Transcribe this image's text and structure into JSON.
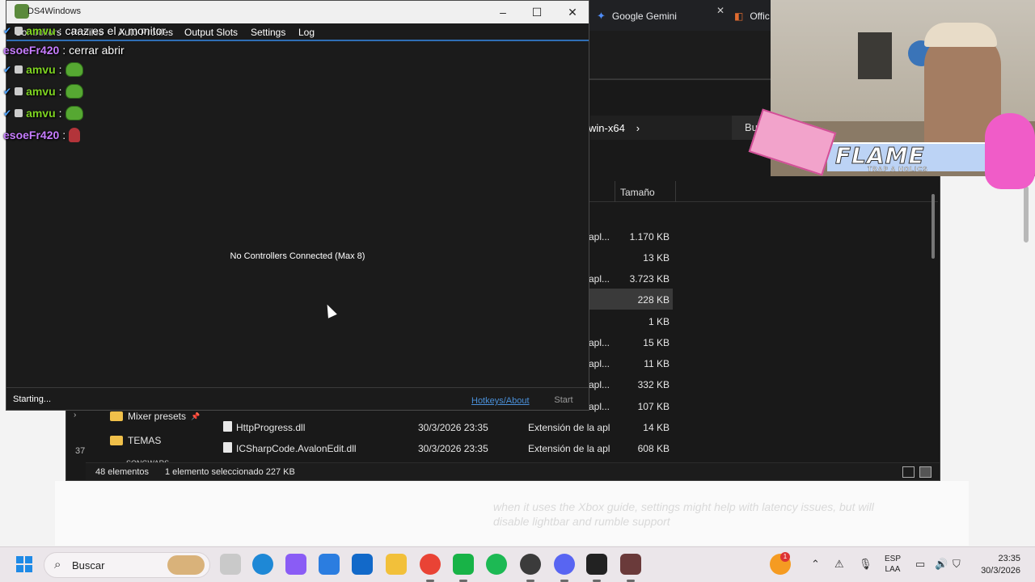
{
  "browser": {
    "tabs": [
      {
        "label": "Google Gemini"
      },
      {
        "label": "Offic"
      }
    ],
    "faded_text": "when it uses the Xbox guide, settings might help with latency issues, but will disable lightbar and rumble support"
  },
  "explorer": {
    "breadcrumb": "win-x64",
    "search_placeholder": "Busc",
    "columns": {
      "size": "Tamaño"
    },
    "rows": [
      {
        "type": "apl...",
        "size": "1.170 KB"
      },
      {
        "type": "",
        "size": "13 KB"
      },
      {
        "type": "apl...",
        "size": "3.723 KB"
      },
      {
        "type": "",
        "size": "228 KB",
        "selected": true
      },
      {
        "type": "",
        "size": "1 KB"
      },
      {
        "type": "apl...",
        "size": "15 KB"
      },
      {
        "type": "apl...",
        "size": "11 KB"
      },
      {
        "type": "apl...",
        "size": "332 KB"
      },
      {
        "type": "apl...",
        "size": "107 KB"
      }
    ],
    "full_rows": [
      {
        "name": "HttpProgress.dll",
        "date": "30/3/2026 23:35",
        "type": "Extensión de la apl...",
        "size": "14 KB"
      },
      {
        "name": "ICSharpCode.AvalonEdit.dll",
        "date": "30/3/2026 23:35",
        "type": "Extensión de la apl...",
        "size": "608 KB"
      }
    ],
    "nav": [
      {
        "label": "Mixer presets"
      },
      {
        "label": "TEMAS"
      }
    ],
    "nav_cut": "SONGWARS",
    "cut_number": "37",
    "status": {
      "count": "48 elementos",
      "selection": "1 elemento seleccionado  227 KB"
    }
  },
  "app": {
    "title": "DS4Windows",
    "menu": [
      "Controllers",
      "Profiles",
      "Auto Profiles",
      "Output Slots",
      "Settings",
      "Log"
    ],
    "no_controllers": "No Controllers Connected (Max 8)",
    "status": "Starting...",
    "hotkeys_link": "Hotkeys/About",
    "start_button": "Start"
  },
  "chat": [
    {
      "user": "amvu",
      "message": "caaz es el x monitor",
      "kind": "text"
    },
    {
      "user": "esoeFr420",
      "message": "cerrar abrir",
      "kind": "text"
    },
    {
      "user": "amvu",
      "message": "",
      "kind": "frog"
    },
    {
      "user": "amvu",
      "message": "",
      "kind": "frog"
    },
    {
      "user": "amvu",
      "message": "",
      "kind": "frog"
    },
    {
      "user": "esoeFr420",
      "message": "",
      "kind": "red"
    }
  ],
  "webcam": {
    "banner": "FLAME",
    "banner_sub": "TRAP A HOLICS"
  },
  "taskbar": {
    "search_label": "Buscar",
    "lang_top": "ESP",
    "lang_bottom": "LAA",
    "time": "23:35",
    "date": "30/3/2026",
    "notification_count": "1",
    "apps": [
      "file-explorer-icon",
      "edge-icon",
      "copilot-icon",
      "store-icon",
      "outlook-icon",
      "folder-icon",
      "chrome-icon",
      "camtasia-icon",
      "spotify-icon",
      "obs-icon",
      "discord-icon",
      "capcut-icon",
      "ds4windows-icon"
    ]
  },
  "colors": {
    "accent_blue": "#2f6fb6",
    "chat_amvu": "#7ed321",
    "chat_esoe": "#c77dff",
    "link": "#4a90d9"
  }
}
